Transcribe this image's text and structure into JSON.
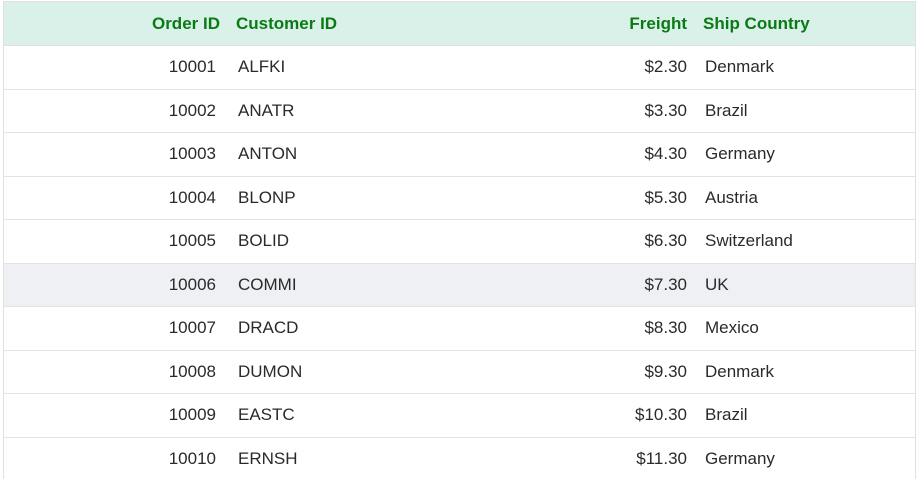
{
  "columns": {
    "order_id": "Order ID",
    "customer_id": "Customer ID",
    "freight": "Freight",
    "ship_country": "Ship Country"
  },
  "rows": [
    {
      "order_id": "10001",
      "customer_id": "ALFKI",
      "freight": "$2.30",
      "ship_country": "Denmark"
    },
    {
      "order_id": "10002",
      "customer_id": "ANATR",
      "freight": "$3.30",
      "ship_country": "Brazil"
    },
    {
      "order_id": "10003",
      "customer_id": "ANTON",
      "freight": "$4.30",
      "ship_country": "Germany"
    },
    {
      "order_id": "10004",
      "customer_id": "BLONP",
      "freight": "$5.30",
      "ship_country": "Austria"
    },
    {
      "order_id": "10005",
      "customer_id": "BOLID",
      "freight": "$6.30",
      "ship_country": "Switzerland"
    },
    {
      "order_id": "10006",
      "customer_id": "COMMI",
      "freight": "$7.30",
      "ship_country": "UK"
    },
    {
      "order_id": "10007",
      "customer_id": "DRACD",
      "freight": "$8.30",
      "ship_country": "Mexico"
    },
    {
      "order_id": "10008",
      "customer_id": "DUMON",
      "freight": "$9.30",
      "ship_country": "Denmark"
    },
    {
      "order_id": "10009",
      "customer_id": "EASTC",
      "freight": "$10.30",
      "ship_country": "Brazil"
    },
    {
      "order_id": "10010",
      "customer_id": "ERNSH",
      "freight": "$11.30",
      "ship_country": "Germany"
    }
  ],
  "hover_row_index": 5,
  "colors": {
    "header_background": "#d9f1e9",
    "header_text": "#0a7a14",
    "hover_row_background": "#eef0f4"
  }
}
